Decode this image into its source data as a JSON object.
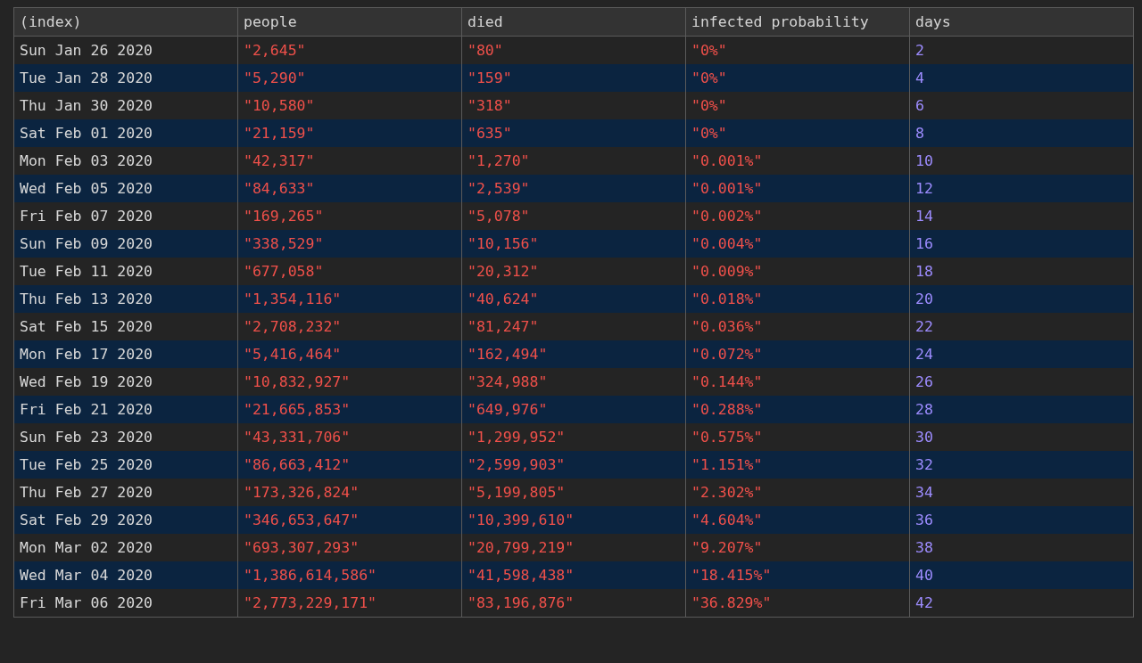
{
  "table": {
    "columns": [
      {
        "label": "(index)",
        "kind": "index"
      },
      {
        "label": "people",
        "kind": "string"
      },
      {
        "label": "died",
        "kind": "string"
      },
      {
        "label": "infected probability",
        "kind": "string"
      },
      {
        "label": "days",
        "kind": "number"
      }
    ],
    "rows": [
      [
        "Sun Jan 26 2020",
        "\"2,645\"",
        "\"80\"",
        "\"0%\"",
        "2"
      ],
      [
        "Tue Jan 28 2020",
        "\"5,290\"",
        "\"159\"",
        "\"0%\"",
        "4"
      ],
      [
        "Thu Jan 30 2020",
        "\"10,580\"",
        "\"318\"",
        "\"0%\"",
        "6"
      ],
      [
        "Sat Feb 01 2020",
        "\"21,159\"",
        "\"635\"",
        "\"0%\"",
        "8"
      ],
      [
        "Mon Feb 03 2020",
        "\"42,317\"",
        "\"1,270\"",
        "\"0.001%\"",
        "10"
      ],
      [
        "Wed Feb 05 2020",
        "\"84,633\"",
        "\"2,539\"",
        "\"0.001%\"",
        "12"
      ],
      [
        "Fri Feb 07 2020",
        "\"169,265\"",
        "\"5,078\"",
        "\"0.002%\"",
        "14"
      ],
      [
        "Sun Feb 09 2020",
        "\"338,529\"",
        "\"10,156\"",
        "\"0.004%\"",
        "16"
      ],
      [
        "Tue Feb 11 2020",
        "\"677,058\"",
        "\"20,312\"",
        "\"0.009%\"",
        "18"
      ],
      [
        "Thu Feb 13 2020",
        "\"1,354,116\"",
        "\"40,624\"",
        "\"0.018%\"",
        "20"
      ],
      [
        "Sat Feb 15 2020",
        "\"2,708,232\"",
        "\"81,247\"",
        "\"0.036%\"",
        "22"
      ],
      [
        "Mon Feb 17 2020",
        "\"5,416,464\"",
        "\"162,494\"",
        "\"0.072%\"",
        "24"
      ],
      [
        "Wed Feb 19 2020",
        "\"10,832,927\"",
        "\"324,988\"",
        "\"0.144%\"",
        "26"
      ],
      [
        "Fri Feb 21 2020",
        "\"21,665,853\"",
        "\"649,976\"",
        "\"0.288%\"",
        "28"
      ],
      [
        "Sun Feb 23 2020",
        "\"43,331,706\"",
        "\"1,299,952\"",
        "\"0.575%\"",
        "30"
      ],
      [
        "Tue Feb 25 2020",
        "\"86,663,412\"",
        "\"2,599,903\"",
        "\"1.151%\"",
        "32"
      ],
      [
        "Thu Feb 27 2020",
        "\"173,326,824\"",
        "\"5,199,805\"",
        "\"2.302%\"",
        "34"
      ],
      [
        "Sat Feb 29 2020",
        "\"346,653,647\"",
        "\"10,399,610\"",
        "\"4.604%\"",
        "36"
      ],
      [
        "Mon Mar 02 2020",
        "\"693,307,293\"",
        "\"20,799,219\"",
        "\"9.207%\"",
        "38"
      ],
      [
        "Wed Mar 04 2020",
        "\"1,386,614,586\"",
        "\"41,598,438\"",
        "\"18.415%\"",
        "40"
      ],
      [
        "Fri Mar 06 2020",
        "\"2,773,229,171\"",
        "\"83,196,876\"",
        "\"36.829%\"",
        "42"
      ]
    ]
  }
}
